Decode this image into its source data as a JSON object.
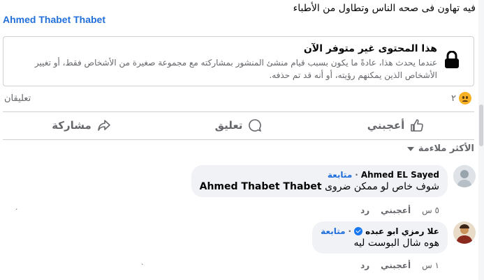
{
  "post": {
    "text": "فيه تهاون فى صحه الناس وتطاول من الأطباء",
    "tagged_name": "Ahmed Thabet Thabet"
  },
  "unavailable": {
    "title": "هذا المحتوى غير متوفر الآن",
    "description": "عندما يحدث هذا، عادةً ما يكون بسبب قيام منشئ المنشور بمشاركته مع مجموعة صغيرة من الأشخاص فقط، أو تغيير الأشخاص الذين يمكنهم رؤيته، أو أنه قد تم حذفه."
  },
  "reactions": {
    "count": "٢",
    "comments_label": "تعليقان",
    "emoji": "sad-emoji"
  },
  "actions": {
    "like": "أعجبني",
    "comment": "تعليق",
    "share": "مشاركة"
  },
  "sort": {
    "label": "الأكثر ملاءمة"
  },
  "comments": [
    {
      "author": "Ahmed EL Sayed",
      "follow": "متابعة",
      "body_prefix": "شوف خاص لو ممكن ضروى",
      "body_tag": "Ahmed Thabet Thabet",
      "time": "٥ س",
      "like": "أعجبني",
      "reply": "رد",
      "dot": "٠"
    },
    {
      "author": "علا رمزي ابو عبده",
      "follow": "متابعة",
      "body": "هوه شال البوست ليه",
      "time": "١ س",
      "like": "أعجبني",
      "reply": "رد",
      "dot": "٠"
    }
  ],
  "colors": {
    "accent": "#216fdb",
    "muted": "#65676b",
    "bubble": "#f0f2f5"
  }
}
